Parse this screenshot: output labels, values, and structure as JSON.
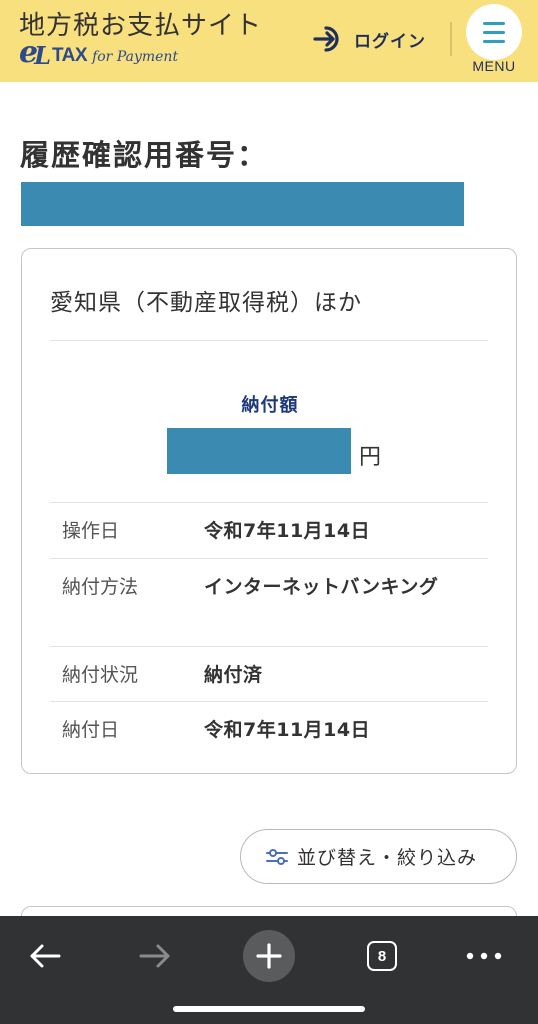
{
  "header": {
    "site_title": "地方税お支払サイト",
    "logo": {
      "e": "e",
      "l": "L",
      "tax": "TAX",
      "for_payment": "for Payment"
    },
    "login_label": "ログイン",
    "menu_label": "MENU"
  },
  "history": {
    "label": "履歴確認用番号："
  },
  "card": {
    "title": "愛知県（不動産取得税）ほか",
    "amount_label": "納付額",
    "yen": "円",
    "rows": [
      {
        "key": "操作日",
        "value": "令和7年11月14日"
      },
      {
        "key": "納付方法",
        "value": "インターネットバンキング"
      },
      {
        "key": "納付状況",
        "value": "納付済"
      },
      {
        "key": "納付日",
        "value": "令和7年11月14日"
      }
    ]
  },
  "sort_button": {
    "label": "並び替え・絞り込み"
  },
  "browser_bar": {
    "tab_count": "8",
    "icons": [
      "back-arrow-icon",
      "forward-arrow-icon",
      "new-tab-plus-icon",
      "tabs-icon",
      "more-icon"
    ]
  },
  "colors": {
    "header_bg": "#f9e07f",
    "redaction": "#3a8ab2",
    "accent_blue": "#1f3a7a",
    "menu_icon": "#2f9fbf",
    "browser_bar": "#313233"
  }
}
